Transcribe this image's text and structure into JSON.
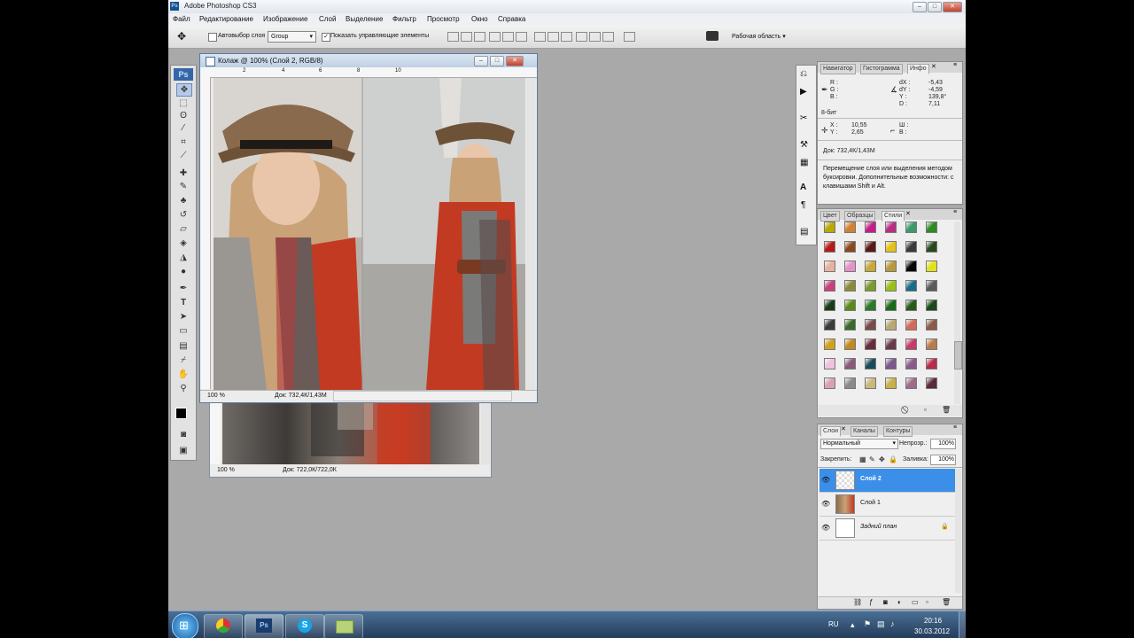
{
  "window_title": "Adobe Photoshop CS3",
  "menu": [
    "Файл",
    "Редактирование",
    "Изображение",
    "Слой",
    "Выделение",
    "Фильтр",
    "Просмотр",
    "Окно",
    "Справка"
  ],
  "options": {
    "autoselect_label": "Автовыбор слоя",
    "autoselect_value": "Group",
    "show_controls_label": "Показать управляющие элементы",
    "workspace_label": "Рабочая область"
  },
  "toolbox": {
    "logo": "Ps"
  },
  "doc_front": {
    "title": "Колаж @ 100% (Слой 2, RGB/8)",
    "zoom": "100 %",
    "doc_size": "Док: 732,4К/1,43М",
    "ruler_marks": [
      "2",
      "4",
      "6",
      "8",
      "10"
    ]
  },
  "doc_back": {
    "zoom": "100 %",
    "doc_size": "Док: 722,0К/722,0К"
  },
  "info_panel": {
    "tabs": [
      "Навигатор",
      "Гистограмма",
      "Инфо"
    ],
    "rgb_labels": [
      "R :",
      "G :",
      "B :"
    ],
    "hsb_labels": [
      "dX :",
      "dY :",
      "Y :",
      "D :"
    ],
    "hsb_values": [
      "-5,43",
      "-4,59",
      "139,8°",
      "7,11"
    ],
    "bit": "8-бит",
    "x_label": "X :",
    "x_value": "10,55",
    "y_label": "Y :",
    "y_value": "2,65",
    "w_label": "Ш :",
    "h_label": "В :",
    "doc_size": "Док: 732,4К/1,43М",
    "hint": "Перемещение слоя или выделения методом буксировки. Дополнительные возможности: с клавишами Shift и Alt."
  },
  "styles_panel": {
    "tabs": [
      "Цвет",
      "Образцы",
      "Стили"
    ],
    "swatch_colors": [
      "#b8a800",
      "#d38030",
      "#c41e8a",
      "#b82e82",
      "#3b9a6a",
      "#2e8a24",
      "#b81818",
      "#8a4a1e",
      "#5a1818",
      "#e2c21a",
      "#3a3a3a",
      "#2a4a1e",
      "#e8b0a0",
      "#e690c8",
      "#c8a838",
      "#b89a3a",
      "#050505",
      "#e2e21a",
      "#c8407a",
      "#8a8a3a",
      "#7a9a2a",
      "#98c01a",
      "#1a6a8a",
      "#5a5a5a",
      "#1a3a1a",
      "#5a8a1a",
      "#2a7a2a",
      "#1a6a1a",
      "#2a5a1a",
      "#1a4a1a",
      "#3a3a3a",
      "#3a6a2a",
      "#7a4a4a",
      "#b8a878",
      "#d06a5a",
      "#8a5a4a",
      "#d0a020",
      "#c08a20",
      "#6a2a3a",
      "#6a3a4a",
      "#c83a6a",
      "#b87a4a",
      "#f0c0e0",
      "#8a5a7a",
      "#1a4a5a",
      "#7a5a8a",
      "#8a5a8a",
      "#b82a4a",
      "#d8a0b0",
      "#8a8a8a",
      "#c8b87a",
      "#c8b04a",
      "#a06a8a",
      "#5a2a3a"
    ]
  },
  "layers_panel": {
    "tabs": [
      "Слои",
      "Каналы",
      "Контуры"
    ],
    "blend_mode": "Нормальный",
    "opacity_label": "Непрозр.:",
    "opacity_value": "100%",
    "lock_label": "Закрепить:",
    "fill_label": "Заливка:",
    "fill_value": "100%",
    "layers": [
      {
        "name": "Слой 2",
        "selected": true
      },
      {
        "name": "Слой 1",
        "selected": false
      },
      {
        "name": "Задний план",
        "selected": false
      }
    ]
  },
  "taskbar": {
    "lang": "RU",
    "time": "20:16",
    "date": "30.03.2012"
  }
}
